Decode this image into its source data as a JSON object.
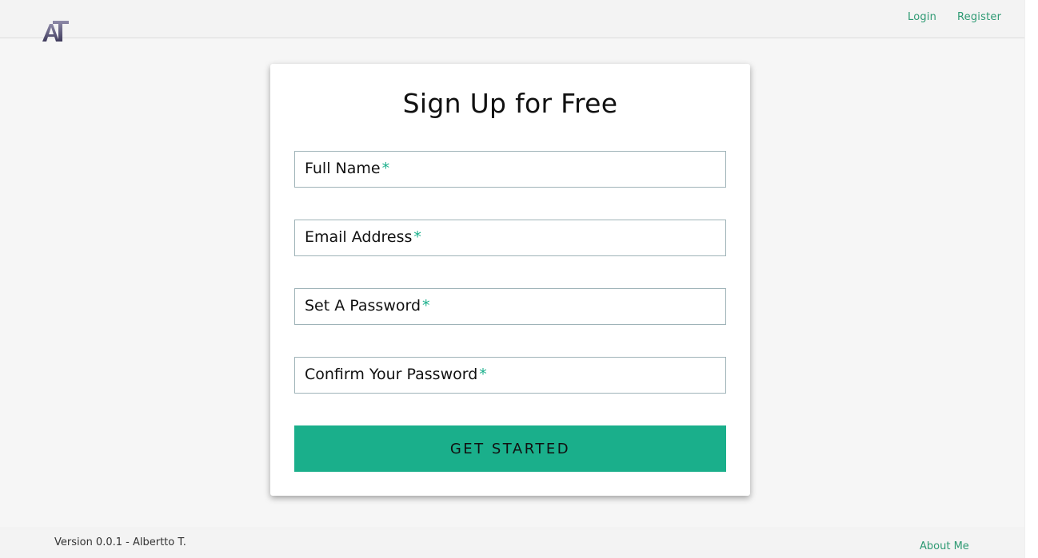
{
  "navbar": {
    "logo_text": "AT",
    "links": {
      "login": "Login",
      "register": "Register"
    }
  },
  "form": {
    "title": "Sign Up for Free",
    "required_marker": "*",
    "fields": [
      {
        "label": "Full Name",
        "value": ""
      },
      {
        "label": "Email Address",
        "value": ""
      },
      {
        "label": "Set A Password",
        "value": ""
      },
      {
        "label": "Confirm Your Password",
        "value": ""
      }
    ],
    "submit_label": "GET STARTED"
  },
  "footer": {
    "version": "Version 0.0.1 - Albertto T.",
    "about": "About Me"
  },
  "colors": {
    "accent": "#1aaf8b",
    "link": "#2e9a73",
    "background": "#f6f6f6"
  }
}
